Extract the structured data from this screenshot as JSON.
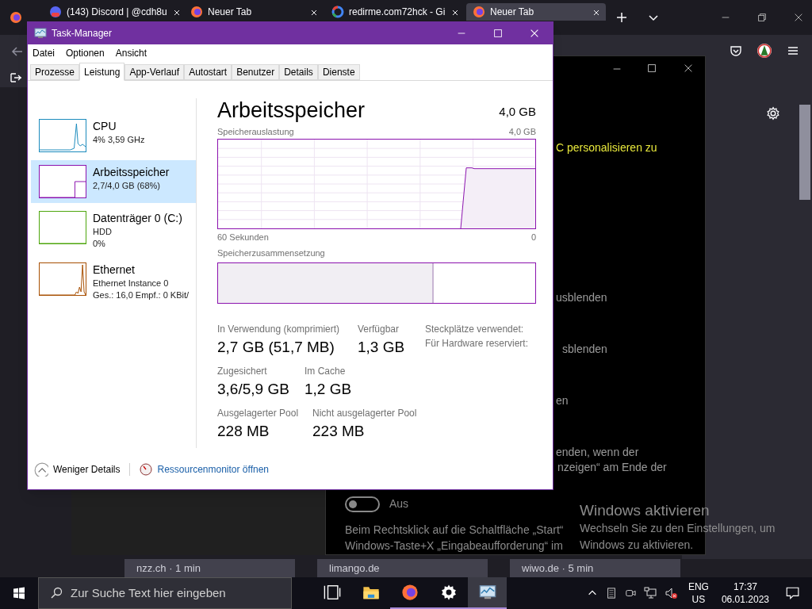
{
  "browser": {
    "tabs": [
      {
        "title": "(143) Discord | @cdh8u",
        "kind": "chat",
        "selected": false
      },
      {
        "title": "Neuer Tab",
        "kind": "browser",
        "selected": false
      },
      {
        "title": "redirme.com72hck - Gi",
        "kind": "search",
        "selected": false
      },
      {
        "title": "Neuer Tab",
        "kind": "browser",
        "selected": true
      }
    ],
    "tiles": [
      "nzz.ch · 1 min",
      "limango.de",
      "wiwo.de · 5 min"
    ]
  },
  "settings_window": {
    "highlight_text": "C personalisieren zu",
    "fragments": [
      "usblenden",
      "sblenden",
      "en",
      "enden, wenn der",
      "nzeigen“ am Ende der"
    ],
    "toggle": {
      "on": false,
      "label": "Aus"
    },
    "paragraph": [
      "Beim Rechtsklick auf die Schaltfläche „Start“",
      "Windows-Taste+X „Eingabeaufforderung“ im"
    ]
  },
  "activation": {
    "title": "Windows aktivieren",
    "lines": [
      "Wechseln Sie zu den Einstellungen, um",
      "Windows zu aktivieren."
    ]
  },
  "task_manager": {
    "title": "Task-Manager",
    "menu": [
      "Datei",
      "Optionen",
      "Ansicht"
    ],
    "tabs": [
      {
        "label": "Prozesse",
        "selected": false
      },
      {
        "label": "Leistung",
        "selected": true
      },
      {
        "label": "App-Verlauf",
        "selected": false
      },
      {
        "label": "Autostart",
        "selected": false
      },
      {
        "label": "Benutzer",
        "selected": false
      },
      {
        "label": "Details",
        "selected": false
      },
      {
        "label": "Dienste",
        "selected": false
      }
    ],
    "resources": [
      {
        "name": "CPU",
        "lines": [
          "4% 3,59 GHz"
        ],
        "color": "#1b8bbd",
        "selected": false
      },
      {
        "name": "Arbeitsspeicher",
        "lines": [
          "2,7/4,0 GB (68%)"
        ],
        "color": "#8b12ae",
        "selected": true
      },
      {
        "name": "Datenträger 0 (C:)",
        "lines": [
          "HDD",
          "0%"
        ],
        "color": "#4da60c",
        "selected": false
      },
      {
        "name": "Ethernet",
        "lines": [
          "Ethernet Instance 0",
          "Ges.: 16,0 Empf.: 0 KBit/"
        ],
        "color": "#a74f01",
        "selected": false
      }
    ],
    "detail": {
      "title": "Arbeitsspeicher",
      "total": "4,0 GB",
      "usage_label": "Speicherauslastung",
      "usage_max": "4,0 GB",
      "time_label": "60 Sekunden",
      "time_end": "0",
      "composition_label": "Speicherzusammensetzung",
      "composition": {
        "level": 0.68
      },
      "stats": [
        {
          "items": [
            {
              "label": "In Verwendung (komprimiert)",
              "value": "2,7 GB (51,7 MB)"
            },
            {
              "label": "Verfügbar",
              "value": "1,3 GB"
            }
          ]
        },
        {
          "items": [
            {
              "label": "Zugesichert",
              "value": "3,6/5,9 GB"
            },
            {
              "label": "Im Cache",
              "value": "1,2 GB"
            }
          ]
        },
        {
          "items": [
            {
              "label": "Ausgelagerter Pool",
              "value": "228 MB"
            },
            {
              "label": "Nicht ausgelagerter Pool",
              "value": "223 MB"
            }
          ]
        }
      ],
      "hardware_labels": [
        "Steckplätze verwendet:",
        "Für Hardware reserviert:"
      ]
    },
    "footer": {
      "less_details": "Weniger Details",
      "resource_monitor": "Ressourcenmonitor öffnen"
    }
  },
  "taskbar": {
    "search_placeholder": "Zur Suche Text hier eingeben",
    "apps": [
      {
        "kind": "taskview",
        "running": false,
        "active": false
      },
      {
        "kind": "explorer",
        "running": false,
        "active": false
      },
      {
        "kind": "firefox",
        "running": true,
        "active": false
      },
      {
        "kind": "settings",
        "running": true,
        "active": false
      },
      {
        "kind": "taskmanager",
        "running": true,
        "active": true
      }
    ],
    "language": "ENG",
    "region": "US",
    "time": "17:37",
    "date": "06.01.2023"
  }
}
